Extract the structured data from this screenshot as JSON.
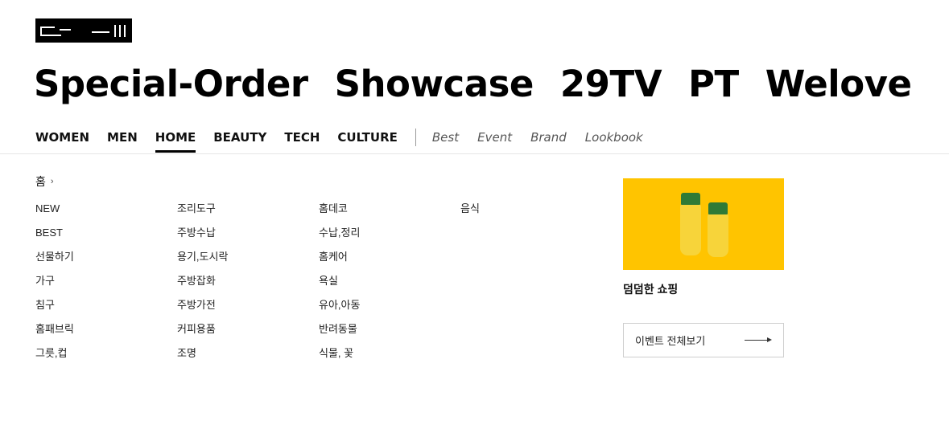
{
  "hero_links": [
    "Special-Order",
    "Showcase",
    "29TV",
    "PT",
    "Welove"
  ],
  "nav": {
    "categories": [
      {
        "label": "WOMEN",
        "active": false
      },
      {
        "label": "MEN",
        "active": false
      },
      {
        "label": "HOME",
        "active": true
      },
      {
        "label": "BEAUTY",
        "active": false
      },
      {
        "label": "TECH",
        "active": false
      },
      {
        "label": "CULTURE",
        "active": false
      }
    ],
    "sub_links": [
      "Best",
      "Event",
      "Brand",
      "Lookbook"
    ]
  },
  "breadcrumb": {
    "label": "홈",
    "chevron": "›"
  },
  "menu_columns": [
    [
      "NEW",
      "BEST",
      "선물하기",
      "가구",
      "침구",
      "홈패브릭",
      "그릇,컵"
    ],
    [
      "조리도구",
      "주방수납",
      "용기,도시락",
      "주방잡화",
      "주방가전",
      "커피용품",
      "조명"
    ],
    [
      "홈데코",
      "수납,정리",
      "홈케어",
      "욕실",
      "유아,아동",
      "반려동물",
      "식물, 꽃"
    ],
    [
      "음식"
    ]
  ],
  "banner": {
    "title": "덤덤한 쇼핑",
    "background_color": "#ffc400"
  },
  "event_button": {
    "label": "이벤트 전체보기"
  }
}
